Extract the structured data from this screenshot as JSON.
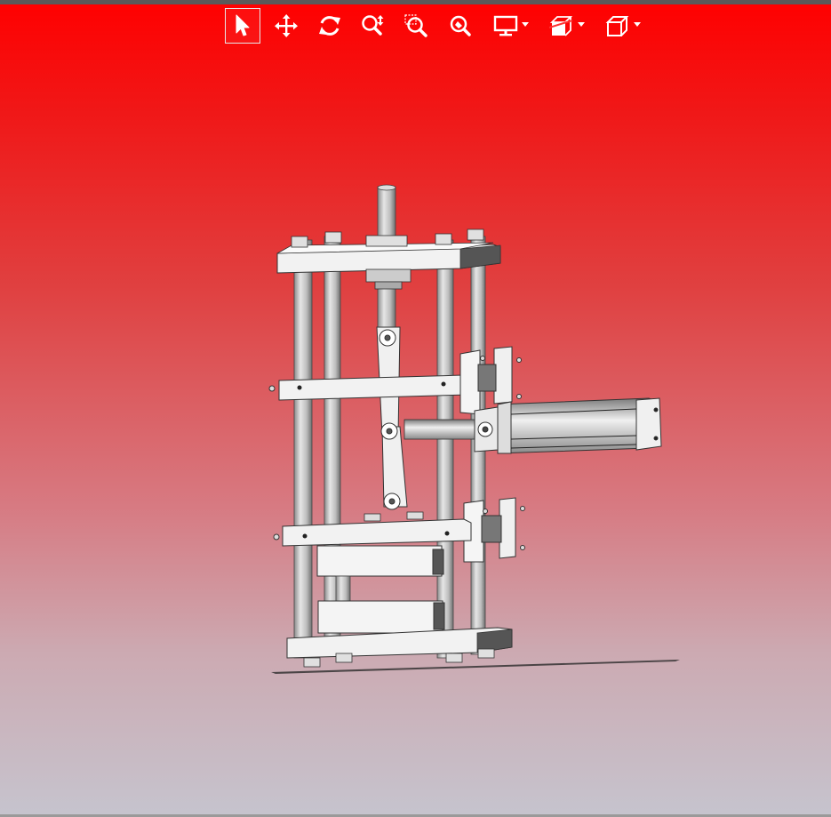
{
  "viewer": {
    "background_top": "#ff0000",
    "background_bottom": "#c6c4ce"
  },
  "toolbar": {
    "tools": [
      {
        "name": "select",
        "icon": "arrow-pointer-icon",
        "selected": true
      },
      {
        "name": "pan",
        "icon": "move-arrows-icon",
        "selected": false
      },
      {
        "name": "rotate",
        "icon": "rotate-icon",
        "selected": false
      },
      {
        "name": "zoom",
        "icon": "zoom-updown-icon",
        "selected": false
      },
      {
        "name": "zoom-window",
        "icon": "zoom-window-icon",
        "selected": false
      },
      {
        "name": "zoom-fit",
        "icon": "zoom-fit-icon",
        "selected": false
      },
      {
        "name": "display-mode",
        "icon": "monitor-icon",
        "dropdown": true
      },
      {
        "name": "section",
        "icon": "section-box-icon",
        "dropdown": true
      },
      {
        "name": "view-orientation",
        "icon": "cube-icon",
        "dropdown": true
      }
    ]
  }
}
